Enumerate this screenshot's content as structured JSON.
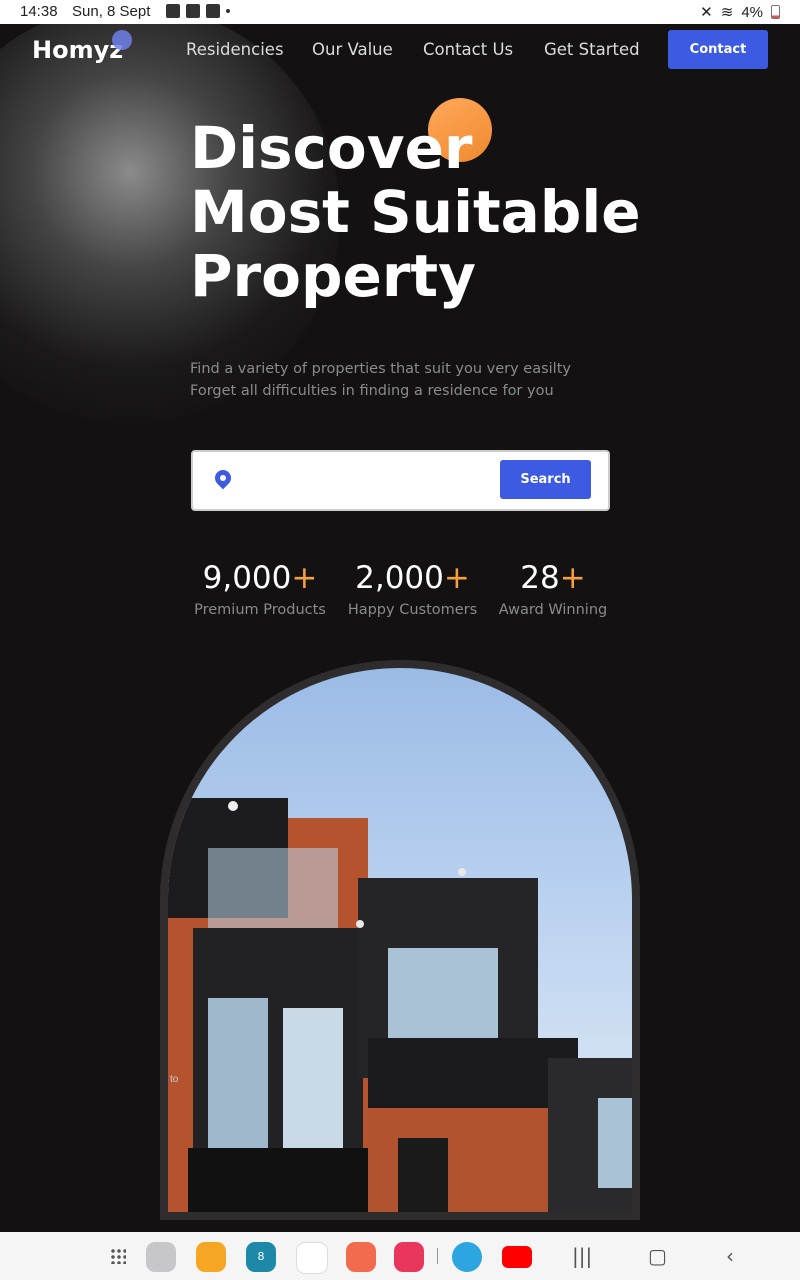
{
  "status_bar": {
    "time": "14:38",
    "date": "Sun, 8 Sept",
    "battery": "4%"
  },
  "header": {
    "logo": "Homyz",
    "nav_items": [
      "Residencies",
      "Our Value",
      "Contact Us",
      "Get Started"
    ],
    "contact_button": "Contact"
  },
  "hero": {
    "headline": [
      "Discover",
      "Most Suitable",
      "Property"
    ],
    "subtitle": [
      "Find a variety of properties that suit you very easilty",
      "Forget all difficulties in finding a residence for you"
    ],
    "search": {
      "value": "",
      "placeholder": "",
      "button_label": "Search"
    },
    "stats": [
      {
        "value": "9,000",
        "suffix": "+",
        "label": "Premium Products"
      },
      {
        "value": "2,000",
        "suffix": "+",
        "label": "Happy Customers"
      },
      {
        "value": "28",
        "suffix": "+",
        "label": "Award Winning"
      }
    ],
    "image_caption_fragment": "to"
  },
  "colors": {
    "accent_blue": "#3d5ae3",
    "accent_orange": "#f5a23a",
    "background": "#131112"
  },
  "system_nav": {
    "apps": [
      "app-drawer-icon",
      "browser-icon",
      "files-icon",
      "calendar-icon",
      "messages-icon",
      "contacts-icon",
      "camera-icon",
      "telegram-icon",
      "youtube-icon"
    ],
    "calendar_day": "8",
    "buttons": [
      "recents-icon",
      "home-icon",
      "back-icon"
    ]
  }
}
